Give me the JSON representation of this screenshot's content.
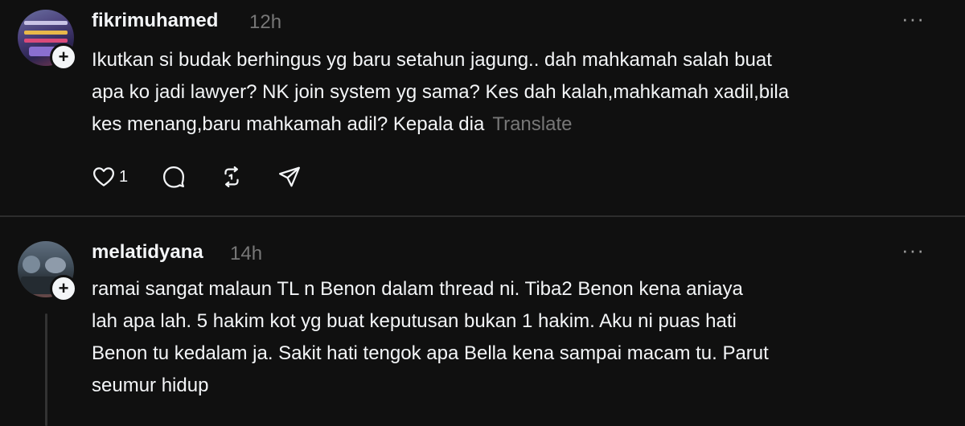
{
  "posts": [
    {
      "username": "fikrimuhamed",
      "time": "12h",
      "more_label": "···",
      "lines": [
        "Ikutkan si budak berhingus yg baru setahun jagung.. dah mahkamah salah buat",
        "apa ko jadi lawyer? NK join system yg sama? Kes dah kalah,mahkamah xadil,bila",
        "kes menang,baru mahkamah adil? Kepala dia"
      ],
      "translate_label": "Translate",
      "follow_symbol": "+",
      "actions": {
        "like_icon": "heart-icon",
        "like_count": "1",
        "reply_icon": "comment-icon",
        "repost_icon": "repost-icon",
        "share_icon": "send-icon"
      }
    },
    {
      "username": "melatidyana",
      "time": "14h",
      "more_label": "···",
      "follow_symbol": "+",
      "lines": [
        "ramai sangat malaun TL n Benon dalam thread ni. Tiba2 Benon kena aniaya",
        "lah apa lah. 5 hakim kot yg buat keputusan bukan 1 hakim. Aku ni puas hati",
        "Benon tu kedalam ja. Sakit hati tengok apa Bella kena sampai macam tu. Parut",
        "seumur hidup"
      ]
    }
  ],
  "colors": {
    "background": "#101010",
    "text": "#f3f5f7",
    "muted": "#777777",
    "divider": "#2d2d2d"
  }
}
